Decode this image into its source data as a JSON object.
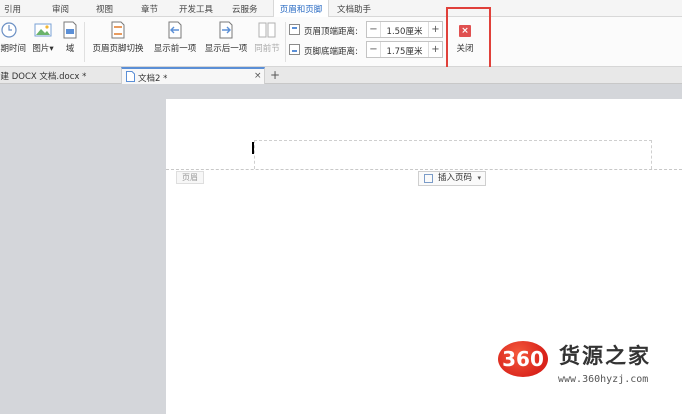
{
  "ribbon_tabs": [
    "引用",
    "审阅",
    "视图",
    "章节",
    "开发工具",
    "云服务",
    "页眉和页脚",
    "文档助手"
  ],
  "active_tab": "页眉和页脚",
  "ribbon": {
    "datetime": "日期时间",
    "picture": "图片",
    "field": "域",
    "switch_header_footer": "页眉页脚切换",
    "show_prev": "显示前一项",
    "show_next": "显示后一项",
    "same_as_prev": "同前节",
    "header_top_label": "页眉顶端距离:",
    "header_top_value": "1.50厘米",
    "footer_bottom_label": "页脚底端距离:",
    "footer_bottom_value": "1.75厘米",
    "minus": "−",
    "plus": "+",
    "close": "关闭",
    "close_icon": "×",
    "dropdown_arrow": "▾"
  },
  "doc_tabs": {
    "tab1": "新建 DOCX 文档.docx *",
    "tab2": "文档2 *",
    "close": "×",
    "add": "+"
  },
  "page": {
    "header_tag": "页眉",
    "insert_page_number": "插入页码",
    "dropdown_arrow": "▾"
  },
  "watermark": {
    "logo_text": "360",
    "site_name": "货源之家",
    "url": "www.360hyzj.com"
  },
  "colors": {
    "accent": "#2b6cc4",
    "highlight_box": "#e0403a",
    "close_icon": "#e05050"
  }
}
